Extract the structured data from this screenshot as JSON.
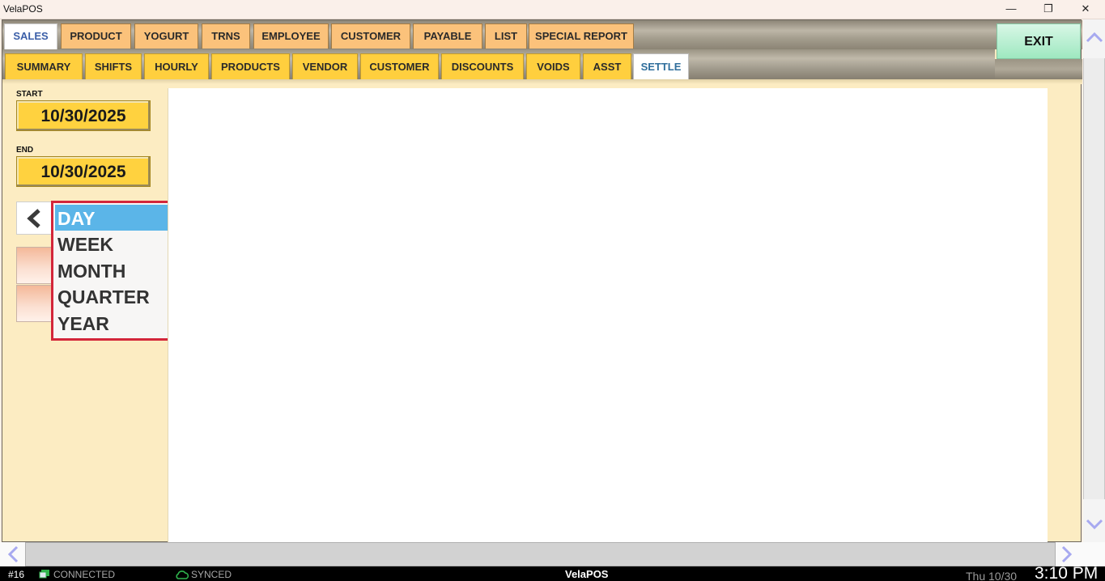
{
  "window": {
    "title": "VelaPOS",
    "minimize_glyph": "—",
    "maximize_glyph": "❐",
    "close_glyph": "✕"
  },
  "main_tabs": [
    "SALES",
    "PRODUCT",
    "YOGURT",
    "TRNS",
    "EMPLOYEE",
    "CUSTOMER",
    "PAYABLE",
    "LIST",
    "SPECIAL REPORT"
  ],
  "main_tab_active": "SALES",
  "exit_label": "EXIT",
  "sub_tabs": [
    "SUMMARY",
    "SHIFTS",
    "HOURLY",
    "PRODUCTS",
    "VENDOR",
    "CUSTOMER",
    "DISCOUNTS",
    "VOIDS",
    "ASST",
    "SETTLE"
  ],
  "sub_tab_active": "SETTLE",
  "left_panel": {
    "start_label": "START",
    "start_date": "10/30/2025",
    "end_label": "END",
    "end_date": "10/30/2025"
  },
  "period_dropdown": {
    "options": [
      "DAY",
      "WEEK",
      "MONTH",
      "QUARTER",
      "YEAR"
    ],
    "selected": "DAY"
  },
  "status_bar": {
    "station": "#16",
    "connection": "CONNECTED",
    "sync": "SYNCED",
    "app_name": "VelaPOS",
    "date": "Thu 10/30",
    "time": "3:10 PM"
  },
  "colors": {
    "main_tab": "#fbc27b",
    "sub_tab": "#ffcf3e",
    "date_button": "#ffd23f",
    "dropdown_border": "#d3263a",
    "dropdown_selected": "#5bb5e8",
    "exit_button": "#9ee8c0",
    "panel_background": "#fcecc2"
  },
  "icons": {
    "prev": "chevron-left-icon",
    "scroll_up": "scroll-up-icon",
    "scroll_down": "scroll-down-icon",
    "scroll_left": "scroll-left-icon",
    "scroll_right": "scroll-right-icon",
    "connected": "monitor-icon",
    "synced": "cloud-icon"
  }
}
